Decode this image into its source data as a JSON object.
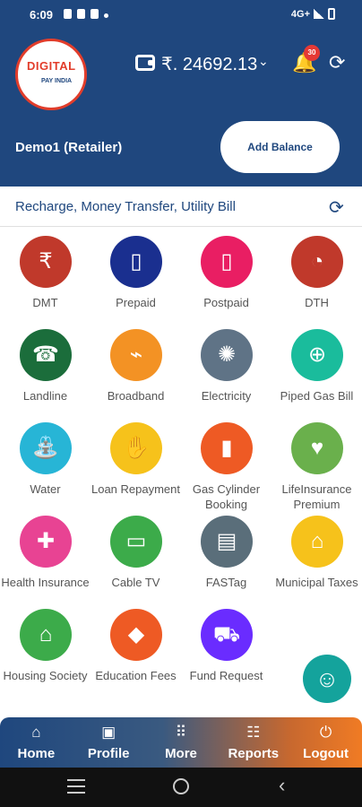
{
  "status_bar": {
    "time": "6:09",
    "network": "4G+"
  },
  "header": {
    "logo_line1": "DIGITAL",
    "logo_line2": "PAY INDIA",
    "balance": "₹. 24692.13",
    "notification_count": "30",
    "user": "Demo1 (Retailer)",
    "add_balance_label": "Add Balance"
  },
  "section": {
    "title": "Recharge, Money Transfer, Utility Bill"
  },
  "services": [
    {
      "label": "DMT",
      "icon": "money-transfer-icon",
      "color": "#c0392b",
      "glyph": "₹"
    },
    {
      "label": "Prepaid",
      "icon": "mobile-prepaid-icon",
      "color": "#1a2f8f",
      "glyph": "▯"
    },
    {
      "label": "Postpaid",
      "icon": "mobile-postpaid-icon",
      "color": "#e91e63",
      "glyph": "▯"
    },
    {
      "label": "DTH",
      "icon": "satellite-dish-icon",
      "color": "#c0392b",
      "glyph": "◔"
    },
    {
      "label": "Landline",
      "icon": "telephone-icon",
      "color": "#1b6d3b",
      "glyph": "☎"
    },
    {
      "label": "Broadband",
      "icon": "router-icon",
      "color": "#f39224",
      "glyph": "⌁"
    },
    {
      "label": "Electricity",
      "icon": "light-bulb-icon",
      "color": "#5f7386",
      "glyph": "✺"
    },
    {
      "label": "Piped Gas Bill",
      "icon": "gas-pipe-icon",
      "color": "#1abc9c",
      "glyph": "⊕"
    },
    {
      "label": "Water",
      "icon": "water-tap-icon",
      "color": "#27b5d6",
      "glyph": "⛲"
    },
    {
      "label": "Loan\nRepayment",
      "icon": "loan-hand-icon",
      "color": "#f6c21b",
      "glyph": "✋"
    },
    {
      "label": "Gas Cylinder\nBooking",
      "icon": "gas-cylinder-icon",
      "color": "#ee5a24",
      "glyph": "▮"
    },
    {
      "label": "LifeInsurance\nPremium",
      "icon": "heart-shield-icon",
      "color": "#6ab04c",
      "glyph": "♥"
    },
    {
      "label": "Health\nInsurance",
      "icon": "health-card-icon",
      "color": "#e84393",
      "glyph": "✚"
    },
    {
      "label": "Cable TV",
      "icon": "cable-tv-icon",
      "color": "#3cab4a",
      "glyph": "▭"
    },
    {
      "label": "FASTag",
      "icon": "fastag-toll-icon",
      "color": "#5a6e7a",
      "glyph": "▤"
    },
    {
      "label": "Municipal\nTaxes",
      "icon": "municipal-building-icon",
      "color": "#f6c21b",
      "glyph": "⌂"
    },
    {
      "label": "Housing\nSociety",
      "icon": "house-location-icon",
      "color": "#3cab4a",
      "glyph": "⌂"
    },
    {
      "label": "Education\nFees",
      "icon": "education-cap-icon",
      "color": "#ee5a24",
      "glyph": "◆"
    },
    {
      "label": "Fund Request",
      "icon": "fund-request-icon",
      "color": "#6a2cff",
      "glyph": "⛟"
    }
  ],
  "bottom_nav": [
    {
      "label": "Home",
      "icon": "home-icon",
      "glyph": "⌂"
    },
    {
      "label": "Profile",
      "icon": "profile-icon",
      "glyph": "▣"
    },
    {
      "label": "More",
      "icon": "grid-more-icon",
      "glyph": "⠿"
    },
    {
      "label": "Reports",
      "icon": "report-clipboard-icon",
      "glyph": "☷"
    },
    {
      "label": "Logout",
      "icon": "power-icon",
      "glyph": "⏻"
    }
  ]
}
